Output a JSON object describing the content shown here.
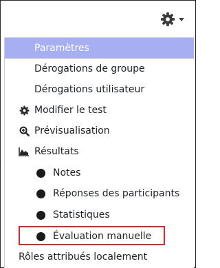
{
  "header": {
    "gear_icon": "gear-icon",
    "caret_icon": "chevron-down-icon"
  },
  "menu": {
    "items": [
      {
        "label": "Paramètres"
      },
      {
        "label": "Dérogations de groupe"
      },
      {
        "label": "Dérogations utilisateur"
      },
      {
        "label": "Modifier le test",
        "icon": "gear-icon"
      },
      {
        "label": "Prévisualisation",
        "icon": "zoom-in-icon"
      },
      {
        "label": "Résultats",
        "icon": "area-chart-icon"
      },
      {
        "label": "Notes",
        "icon": "bullet-icon"
      },
      {
        "label": "Réponses des participants",
        "icon": "bullet-icon"
      },
      {
        "label": "Statistiques",
        "icon": "bullet-icon"
      },
      {
        "label": "Évaluation manuelle",
        "icon": "bullet-icon"
      },
      {
        "label": "Rôles attribués localement"
      }
    ]
  },
  "colors": {
    "active_background": "#a8aef2",
    "active_text": "#ffffff",
    "highlight_border": "#e0232f"
  }
}
